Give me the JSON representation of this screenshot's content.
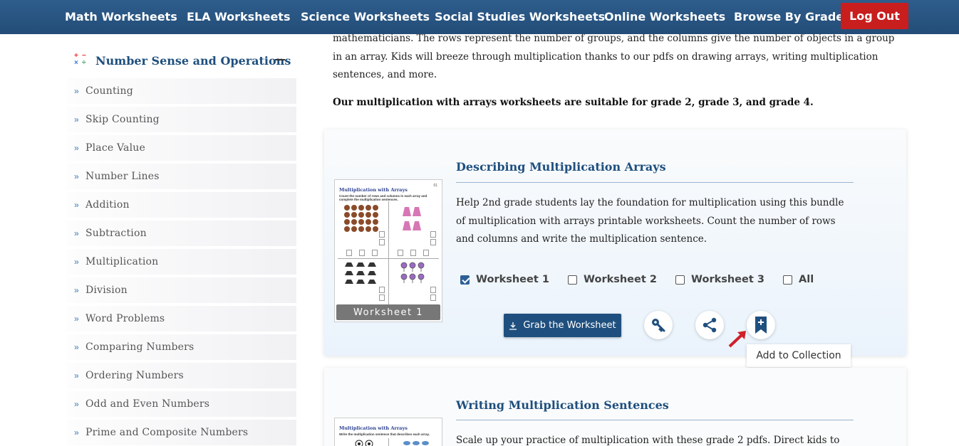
{
  "nav": {
    "items": [
      "Math Worksheets",
      "ELA Worksheets",
      "Science Worksheets",
      "Social Studies Worksheets",
      "Online Worksheets",
      "Browse By Grade"
    ],
    "logout": "Log Out"
  },
  "sidebar": {
    "title": "Number Sense and Operations",
    "items": [
      "Counting",
      "Skip Counting",
      "Place Value",
      "Number Lines",
      "Addition",
      "Subtraction",
      "Multiplication",
      "Division",
      "Word Problems",
      "Comparing Numbers",
      "Ordering Numbers",
      "Odd and Even Numbers",
      "Prime and Composite Numbers"
    ]
  },
  "intro": {
    "line1": "mathematicians. The rows represent the number of groups, and the columns give the number of objects in a group",
    "line2": "in an array. Kids will breeze through multiplication thanks to our pdfs on drawing arrays, writing multiplication",
    "line3": "sentences, and more.",
    "grades": "Our multiplication with arrays worksheets are suitable for grade 2, grade 3, and grade 4."
  },
  "card1": {
    "title": "Describing Multiplication Arrays",
    "desc1": "Help 2nd grade students lay the foundation for multiplication using this bundle",
    "desc2": "of multiplication with arrays printable worksheets. Count the number of rows",
    "desc3": "and columns and write the multiplication sentence.",
    "thumb_title": "Multiplication with Arrays",
    "thumb_sub": "Count the number of rows and columns in each array and complete the multiplication sentences.",
    "thumb_num": "01",
    "thumb_badge": "Worksheet 1",
    "options": [
      {
        "label": "Worksheet 1",
        "checked": true
      },
      {
        "label": "Worksheet 2",
        "checked": false
      },
      {
        "label": "Worksheet 3",
        "checked": false
      },
      {
        "label": "All",
        "checked": false
      }
    ],
    "grab_label": "Grab the Worksheet",
    "tooltip": "Add to Collection"
  },
  "card2": {
    "title": "Writing Multiplication Sentences",
    "desc1": "Scale up your practice of multiplication with these grade 2 pdfs. Direct kids to",
    "thumb_title": "Multiplication with Arrays",
    "thumb_sub": "Write the multiplication sentence that describes each array."
  },
  "colors": {
    "nav_bg": "#2b5a89",
    "logout": "#c81e1e",
    "title": "#1e4f7e",
    "button": "#1f4f7e",
    "arrow": "#d0202a"
  },
  "icons": [
    "math-ops-icon",
    "download-icon",
    "key-icon",
    "share-icon",
    "bookmark-add-icon",
    "red-arrow-icon"
  ]
}
